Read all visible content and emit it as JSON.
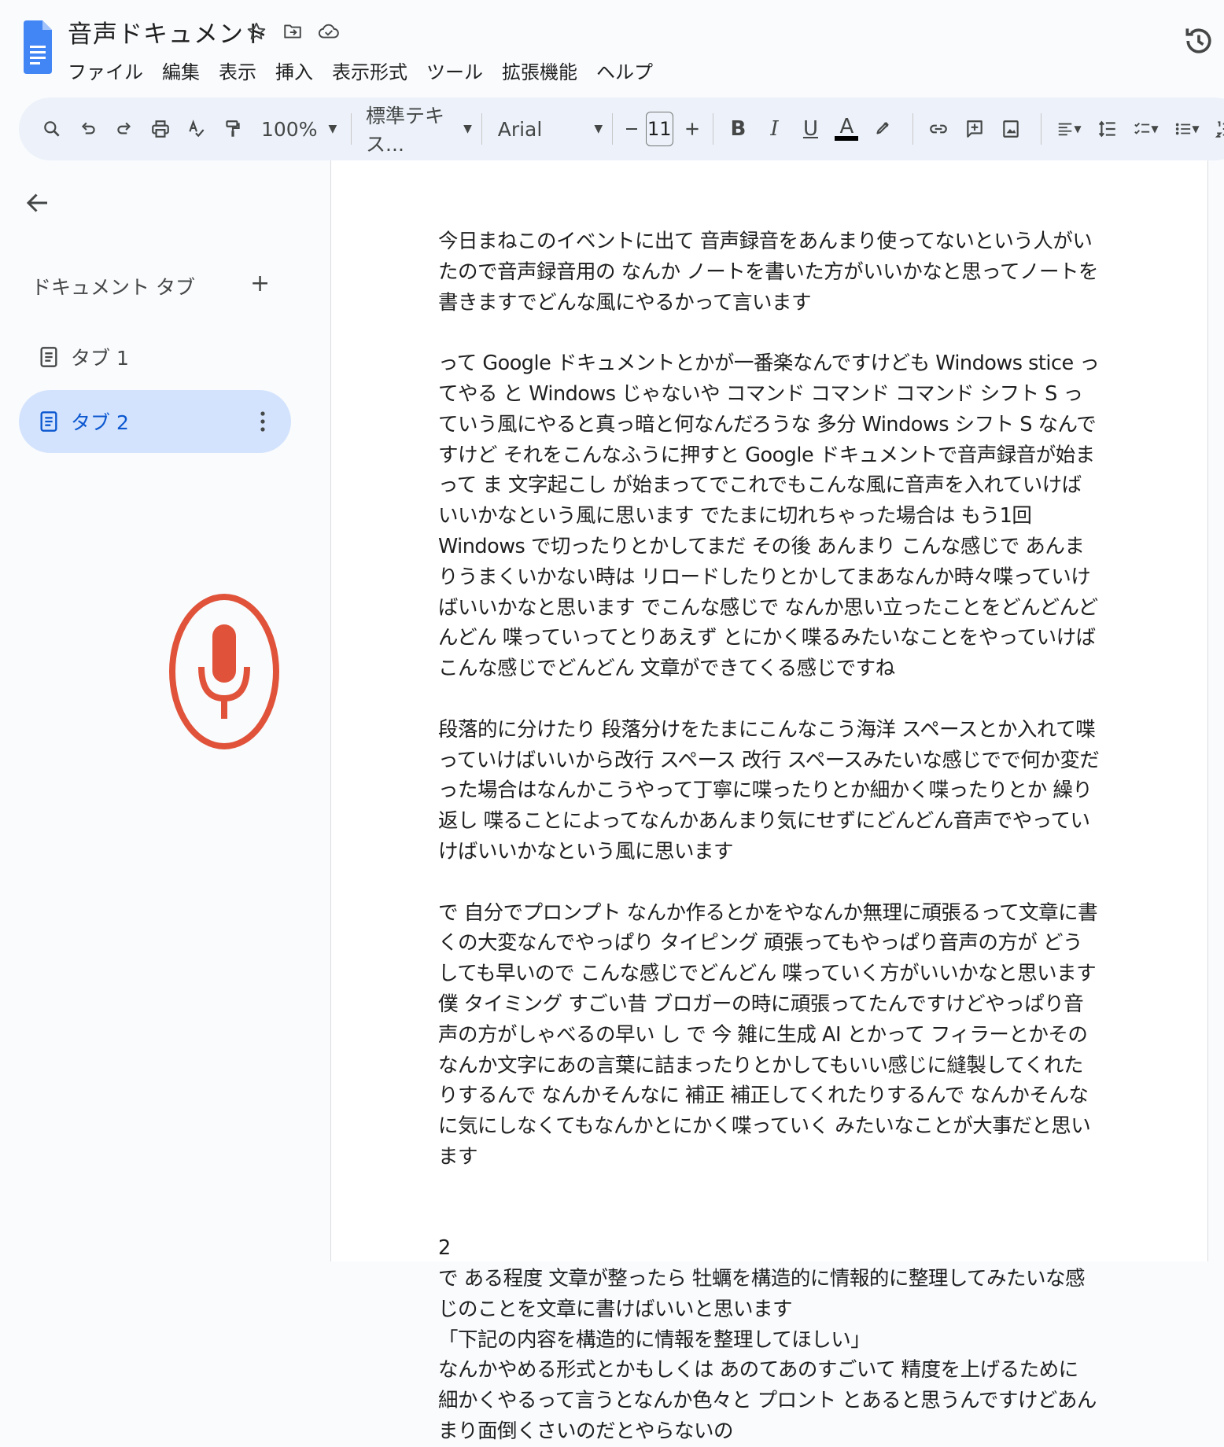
{
  "header": {
    "title": "音声ドキュメント",
    "menu": [
      "ファイル",
      "編集",
      "表示",
      "挿入",
      "表示形式",
      "ツール",
      "拡張機能",
      "ヘルプ"
    ]
  },
  "toolbar": {
    "zoom": "100%",
    "style": "標準テキス...",
    "font": "Arial",
    "font_size": "11",
    "bold": "B",
    "italic": "I",
    "underline": "U",
    "text_color": "A"
  },
  "sidebar": {
    "heading": "ドキュメント タブ",
    "add": "+",
    "tabs": [
      {
        "label": "タブ 1"
      },
      {
        "label": "タブ 2"
      }
    ]
  },
  "colors": {
    "accent": "#0b57d0",
    "active_tab_bg": "#d3e3fd",
    "toolbar_bg": "#edf2fa",
    "mic": "#e0533a",
    "docs_blue": "#4285f4"
  },
  "document": {
    "p1": "今日まねこのイベントに出て 音声録音をあんまり使ってないという人がいたので音声録音用の なんか ノートを書いた方がいいかなと思ってノートを書きますでどんな風にやるかって言います",
    "p2": "って Google ドキュメントとかが一番楽なんですけども Windows stice ってやる と Windows じゃないや コマンド コマンド コマンド シフト S っていう風にやると真っ暗と何なんだろうな 多分 Windows シフト S なんですけど それをこんなふうに押すと Google ドキュメントで音声録音が始まって ま 文字起こし が始まってでこれでもこんな風に音声を入れていけばいいかなという風に思います でたまに切れちゃった場合は もう1回 Windows で切ったりとかしてまだ その後 あんまり こんな感じで あんまりうまくいかない時は リロードしたりとかしてまあなんか時々喋っていけばいいかなと思います でこんな感じで なんか思い立ったことをどんどんどんどん 喋っていってとりあえず とにかく喋るみたいなことをやっていけば こんな感じでどんどん 文章ができてくる感じですね",
    "p3": " 段落的に分けたり 段落分けをたまにこんなこう海洋 スペースとか入れて喋っていけばいいから改行 スペース 改行 スペースみたいな感じでで何か変だった場合はなんかこうやって丁寧に喋ったりとか細かく喋ったりとか 繰り返し 喋ることによってなんかあんまり気にせずにどんどん音声でやっていけばいいかなという風に思います",
    "p4": "で 自分でプロンプト なんか作るとかをやなんか無理に頑張るって文章に書くの大変なんでやっぱり タイピング 頑張ってもやっぱり音声の方が どうしても早いので こんな感じでどんどん 喋っていく方がいいかなと思います 僕 タイミング すごい昔 ブロガーの時に頑張ってたんですけどやっぱり音声の方がしゃべるの早い し で 今 雑に生成 AI とかって フィラーとかその なんか文字にあの言葉に詰まったりとかしてもいい感じに縫製してくれたりするんで なんかそんなに 補正 補正してくれたりするんで なんかそんなに気にしなくてもなんかとにかく喋っていく みたいなことが大事だと思います",
    "p5_num": "2",
    "p5a": " で ある程度 文章が整ったら 牡蠣を構造的に情報的に整理してみたいな感じのことを文章に書けばいいと思います",
    "p5b": "「下記の内容を構造的に情報を整理してほしい」",
    "p5c": "なんかやめる形式とかもしくは あのてあのすごいて 精度を上げるために 細かくやるって言うとなんか色々と プロント とあると思うんですけどあんまり面倒くさいのだとやらないの"
  }
}
